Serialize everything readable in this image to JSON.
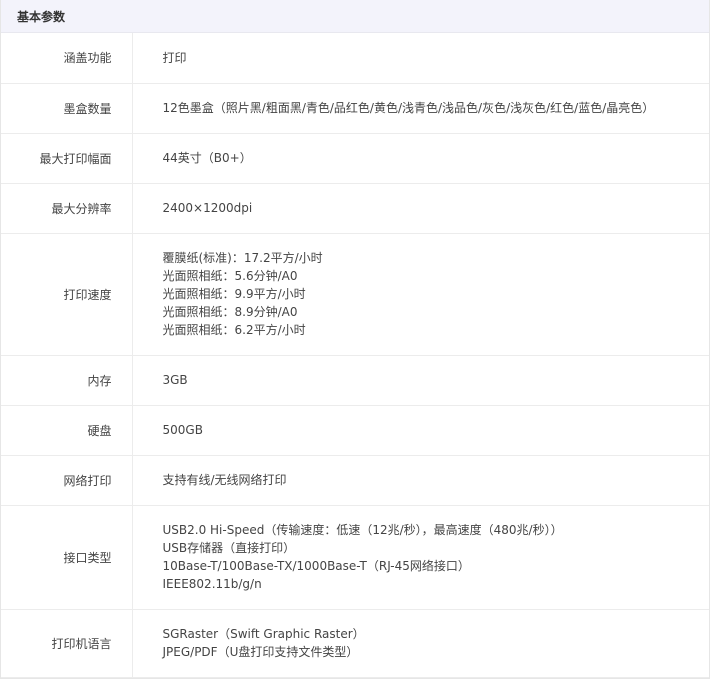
{
  "section_title": "基本参数",
  "rows": [
    {
      "label": "涵盖功能",
      "lines": [
        "打印"
      ]
    },
    {
      "label": "墨盒数量",
      "lines": [
        "12色墨盒（照片黑/粗面黑/青色/品红色/黄色/浅青色/浅品色/灰色/浅灰色/红色/蓝色/晶亮色）"
      ]
    },
    {
      "label": "最大打印幅面",
      "lines": [
        "44英寸（B0+）"
      ]
    },
    {
      "label": "最大分辨率",
      "lines": [
        "2400×1200dpi"
      ]
    },
    {
      "label": "打印速度",
      "lines": [
        "覆膜纸(标准)：17.2平方/小时",
        "光面照相纸：5.6分钟/A0",
        "光面照相纸：9.9平方/小时",
        "光面照相纸：8.9分钟/A0",
        "光面照相纸：6.2平方/小时"
      ]
    },
    {
      "label": "内存",
      "lines": [
        "3GB"
      ]
    },
    {
      "label": "硬盘",
      "lines": [
        "500GB"
      ]
    },
    {
      "label": "网络打印",
      "lines": [
        "支持有线/无线网络打印"
      ]
    },
    {
      "label": "接口类型",
      "lines": [
        "USB2.0 Hi-Speed（传输速度：低速（12兆/秒），最高速度（480兆/秒））",
        "USB存储器（直接打印）",
        "10Base-T/100Base-TX/1000Base-T（RJ-45网络接口）",
        "IEEE802.11b/g/n"
      ]
    },
    {
      "label": "打印机语言",
      "lines": [
        "SGRaster（Swift Graphic Raster）",
        "JPEG/PDF（U盘打印支持文件类型）"
      ]
    }
  ]
}
